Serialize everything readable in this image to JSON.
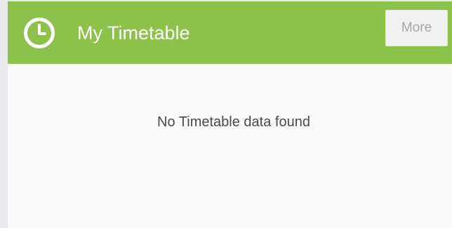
{
  "header": {
    "title": "My Timetable",
    "icon": "clock-icon",
    "more_label": "More"
  },
  "body": {
    "empty_message": "No Timetable data found"
  },
  "colors": {
    "header_bg": "#8bc34a",
    "page_bg": "#e8e9ec",
    "card_bg": "#fafafa"
  }
}
